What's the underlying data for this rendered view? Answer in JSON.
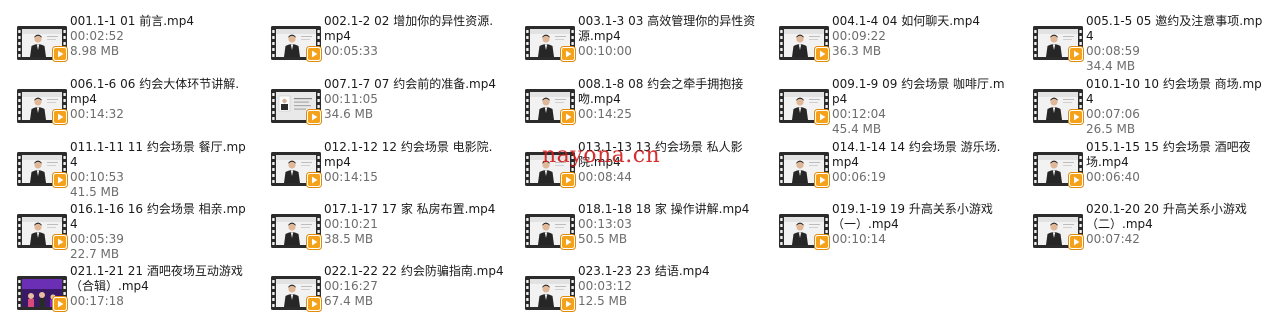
{
  "icons": {
    "thumbnail": "video-thumbnail-icon",
    "play_badge": "play-badge-icon"
  },
  "colors": {
    "filmstrip": "#2b2b2b",
    "play_badge": "#f4a21c",
    "name_text": "#1a1a1a",
    "meta_text": "#6d6d6d",
    "watermark": "#d01a1a"
  },
  "watermark": "nayona.cn",
  "files": [
    {
      "name": "001.1-1 01 前言.mp4",
      "duration": "00:02:52",
      "size": "8.98 MB",
      "thumb": "presenter"
    },
    {
      "name": "002.1-2 02 增加你的异性资源.mp4",
      "duration": "00:05:33",
      "size": "",
      "thumb": "presenter"
    },
    {
      "name": "003.1-3 03 高效管理你的异性资源.mp4",
      "duration": "00:10:00",
      "size": "",
      "thumb": "presenter"
    },
    {
      "name": "004.1-4 04 如何聊天.mp4",
      "duration": "00:09:22",
      "size": "36.3 MB",
      "thumb": "presenter"
    },
    {
      "name": "005.1-5 05 邀约及注意事项.mp4",
      "duration": "00:08:59",
      "size": "34.4 MB",
      "thumb": "presenter"
    },
    {
      "name": "006.1-6 06 约会大体环节讲解.mp4",
      "duration": "00:14:32",
      "size": "",
      "thumb": "presenter"
    },
    {
      "name": "007.1-7 07 约会前的准备.mp4",
      "duration": "00:11:05",
      "size": "34.6 MB",
      "thumb": "slides"
    },
    {
      "name": "008.1-8 08 约会之牵手拥抱接吻.mp4",
      "duration": "00:14:25",
      "size": "",
      "thumb": "presenter"
    },
    {
      "name": "009.1-9 09 约会场景 咖啡厅.mp4",
      "duration": "00:12:04",
      "size": "45.4 MB",
      "thumb": "presenter"
    },
    {
      "name": "010.1-10 10 约会场景 商场.mp4",
      "duration": "00:07:06",
      "size": "26.5 MB",
      "thumb": "presenter"
    },
    {
      "name": "011.1-11 11 约会场景 餐厅.mp4",
      "duration": "00:10:53",
      "size": "41.5 MB",
      "thumb": "presenter"
    },
    {
      "name": "012.1-12 12 约会场景 电影院.mp4",
      "duration": "00:14:15",
      "size": "",
      "thumb": "presenter"
    },
    {
      "name": "013.1-13 13 约会场景 私人影院.mp4",
      "duration": "00:08:44",
      "size": "",
      "thumb": "presenter"
    },
    {
      "name": "014.1-14 14 约会场景 游乐场.mp4",
      "duration": "00:06:19",
      "size": "",
      "thumb": "presenter"
    },
    {
      "name": "015.1-15 15 约会场景 酒吧夜场.mp4",
      "duration": "00:06:40",
      "size": "",
      "thumb": "presenter"
    },
    {
      "name": "016.1-16 16 约会场景 相亲.mp4",
      "duration": "00:05:39",
      "size": "22.7 MB",
      "thumb": "presenter"
    },
    {
      "name": "017.1-17 17 家 私房布置.mp4",
      "duration": "00:10:21",
      "size": "38.5 MB",
      "thumb": "presenter"
    },
    {
      "name": "018.1-18 18 家 操作讲解.mp4",
      "duration": "00:13:03",
      "size": "50.5 MB",
      "thumb": "presenter"
    },
    {
      "name": "019.1-19 19 升高关系小游戏（一）.mp4",
      "duration": "00:10:14",
      "size": "",
      "thumb": "presenter"
    },
    {
      "name": "020.1-20 20 升高关系小游戏（二）.mp4",
      "duration": "00:07:42",
      "size": "",
      "thumb": "presenter"
    },
    {
      "name": "021.1-21 21 酒吧夜场互动游戏（合辑）.mp4",
      "duration": "00:17:18",
      "size": "",
      "thumb": "nightclub"
    },
    {
      "name": "022.1-22 22 约会防骗指南.mp4",
      "duration": "00:16:27",
      "size": "67.4 MB",
      "thumb": "presenter"
    },
    {
      "name": "023.1-23 23 结语.mp4",
      "duration": "00:03:12",
      "size": "12.5 MB",
      "thumb": "presenter"
    }
  ]
}
